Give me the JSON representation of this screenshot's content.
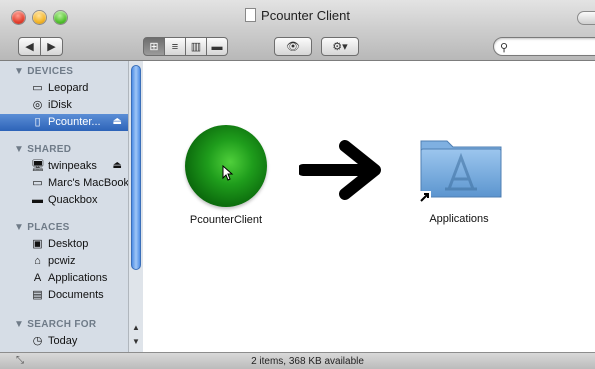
{
  "window": {
    "title": "Pcounter Client"
  },
  "toolbar": {
    "back_icon": "chevron-left-icon",
    "forward_icon": "chevron-right-icon",
    "view_modes": [
      "icon",
      "list",
      "column",
      "coverflow"
    ],
    "selected_view": "icon",
    "search_placeholder": ""
  },
  "sidebar": {
    "sections": [
      {
        "title": "▼ DEVICES",
        "items": [
          {
            "label": "Leopard",
            "icon": "hard-drive-icon"
          },
          {
            "label": "iDisk",
            "icon": "idisk-icon"
          },
          {
            "label": "Pcounter...",
            "icon": "disk-image-icon",
            "selected": true,
            "eject": true
          }
        ]
      },
      {
        "title": "▼ SHARED",
        "items": [
          {
            "label": "twinpeaks",
            "icon": "computer-icon",
            "eject": true
          },
          {
            "label": "Marc's MacBook",
            "icon": "laptop-icon"
          },
          {
            "label": "Quackbox",
            "icon": "server-icon"
          }
        ]
      },
      {
        "title": "▼ PLACES",
        "items": [
          {
            "label": "Desktop",
            "icon": "desktop-icon"
          },
          {
            "label": "pcwiz",
            "icon": "home-icon"
          },
          {
            "label": "Applications",
            "icon": "applications-icon"
          },
          {
            "label": "Documents",
            "icon": "documents-icon"
          }
        ]
      },
      {
        "title": "▼ SEARCH FOR",
        "items": [
          {
            "label": "Today",
            "icon": "clock-icon"
          }
        ]
      }
    ]
  },
  "content": {
    "items": [
      {
        "name": "PcounterClient",
        "icon": "green-sphere-icon"
      },
      {
        "name": "Applications",
        "icon": "applications-folder-alias-icon"
      }
    ]
  },
  "status": {
    "text": "2 items, 368 KB available"
  }
}
